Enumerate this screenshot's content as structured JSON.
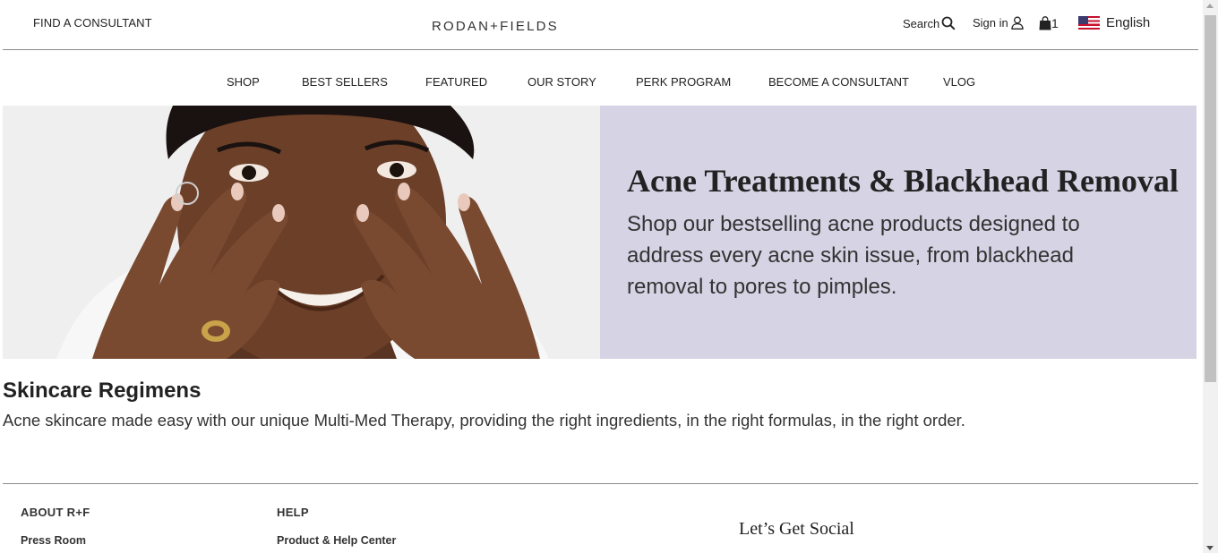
{
  "header": {
    "find_consultant": "FIND A CONSULTANT",
    "logo": "RODAN+FIELDS",
    "search_label": "Search",
    "signin_label": "Sign in",
    "bag_count": "1",
    "language": "English"
  },
  "nav": {
    "items": [
      {
        "label": "SHOP"
      },
      {
        "label": "BEST SELLERS"
      },
      {
        "label": "FEATURED"
      },
      {
        "label": "OUR STORY"
      },
      {
        "label": "PERK PROGRAM"
      },
      {
        "label": "BECOME A CONSULTANT"
      },
      {
        "label": "VLOG"
      }
    ]
  },
  "hero": {
    "title": "Acne Treatments & Blackhead Removal",
    "text": "Shop our bestselling acne products designed to address every acne skin issue, from blackhead removal to pores to pimples.",
    "panel_color": "#d6d3e4"
  },
  "regimens": {
    "title": "Skincare Regimens",
    "text": "Acne skincare made easy with our unique Multi-Med Therapy, providing the right ingredients, in the right formulas, in the right order."
  },
  "footer": {
    "about_heading": "ABOUT R+F",
    "about_link": "Press Room",
    "help_heading": "HELP",
    "help_link": "Product & Help Center",
    "social_title": "Let’s Get Social"
  },
  "icons": {
    "search": "search-icon",
    "user": "user-icon",
    "bag": "shopping-bag-icon",
    "flag": "us-flag-icon"
  }
}
